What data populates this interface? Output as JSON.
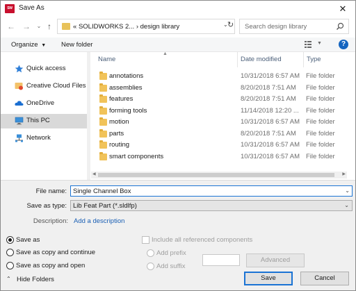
{
  "window": {
    "title": "Save As",
    "app_icon": "solidworks-logo"
  },
  "nav": {
    "back_icon": "back-arrow",
    "forward_icon": "forward-arrow",
    "recent_icon": "chevron-down",
    "up_icon": "up-arrow",
    "path_prefix": "«",
    "path_parent": "SOLIDWORKS 2...",
    "path_separator": "›",
    "path_current": "design library",
    "search_placeholder": "Search design library"
  },
  "toolbar": {
    "organize_label": "Organize",
    "new_folder_label": "New folder"
  },
  "sidebar": {
    "items": [
      {
        "label": "Quick access",
        "icon": "star-icon"
      },
      {
        "label": "Creative Cloud Files",
        "icon": "creative-cloud-icon"
      },
      {
        "label": "OneDrive",
        "icon": "cloud-icon"
      },
      {
        "label": "This PC",
        "icon": "computer-icon",
        "selected": true
      },
      {
        "label": "Network",
        "icon": "network-icon"
      }
    ]
  },
  "files": {
    "columns": {
      "name": "Name",
      "date": "Date modified",
      "type": "Type"
    },
    "rows": [
      {
        "name": "annotations",
        "date": "10/31/2018 6:57 AM",
        "type": "File folder"
      },
      {
        "name": "assemblies",
        "date": "8/20/2018 7:51 AM",
        "type": "File folder"
      },
      {
        "name": "features",
        "date": "8/20/2018 7:51 AM",
        "type": "File folder"
      },
      {
        "name": "forming tools",
        "date": "11/14/2018 12:20 ...",
        "type": "File folder"
      },
      {
        "name": "motion",
        "date": "10/31/2018 6:57 AM",
        "type": "File folder"
      },
      {
        "name": "parts",
        "date": "8/20/2018 7:51 AM",
        "type": "File folder"
      },
      {
        "name": "routing",
        "date": "10/31/2018 6:57 AM",
        "type": "File folder"
      },
      {
        "name": "smart components",
        "date": "10/31/2018 6:57 AM",
        "type": "File folder"
      }
    ]
  },
  "form": {
    "file_name_label": "File name:",
    "file_name_value": "Single Channel Box",
    "save_type_label": "Save as type:",
    "save_type_value": "Lib Feat Part (*.sldlfp)",
    "description_label": "Description:",
    "description_link": "Add a description",
    "save_options": [
      "Save as",
      "Save as copy and continue",
      "Save as copy and open"
    ],
    "selected_option": "Save as",
    "include_refs_label": "Include all referenced components",
    "add_prefix_label": "Add prefix",
    "add_suffix_label": "Add suffix",
    "advanced_label": "Advanced",
    "hide_folders_label": "Hide Folders",
    "save_label": "Save",
    "cancel_label": "Cancel"
  },
  "colors": {
    "accent": "#1a73d4",
    "folder": "#f1c35a",
    "link": "#1a5fb4",
    "help": "#1565c0"
  }
}
